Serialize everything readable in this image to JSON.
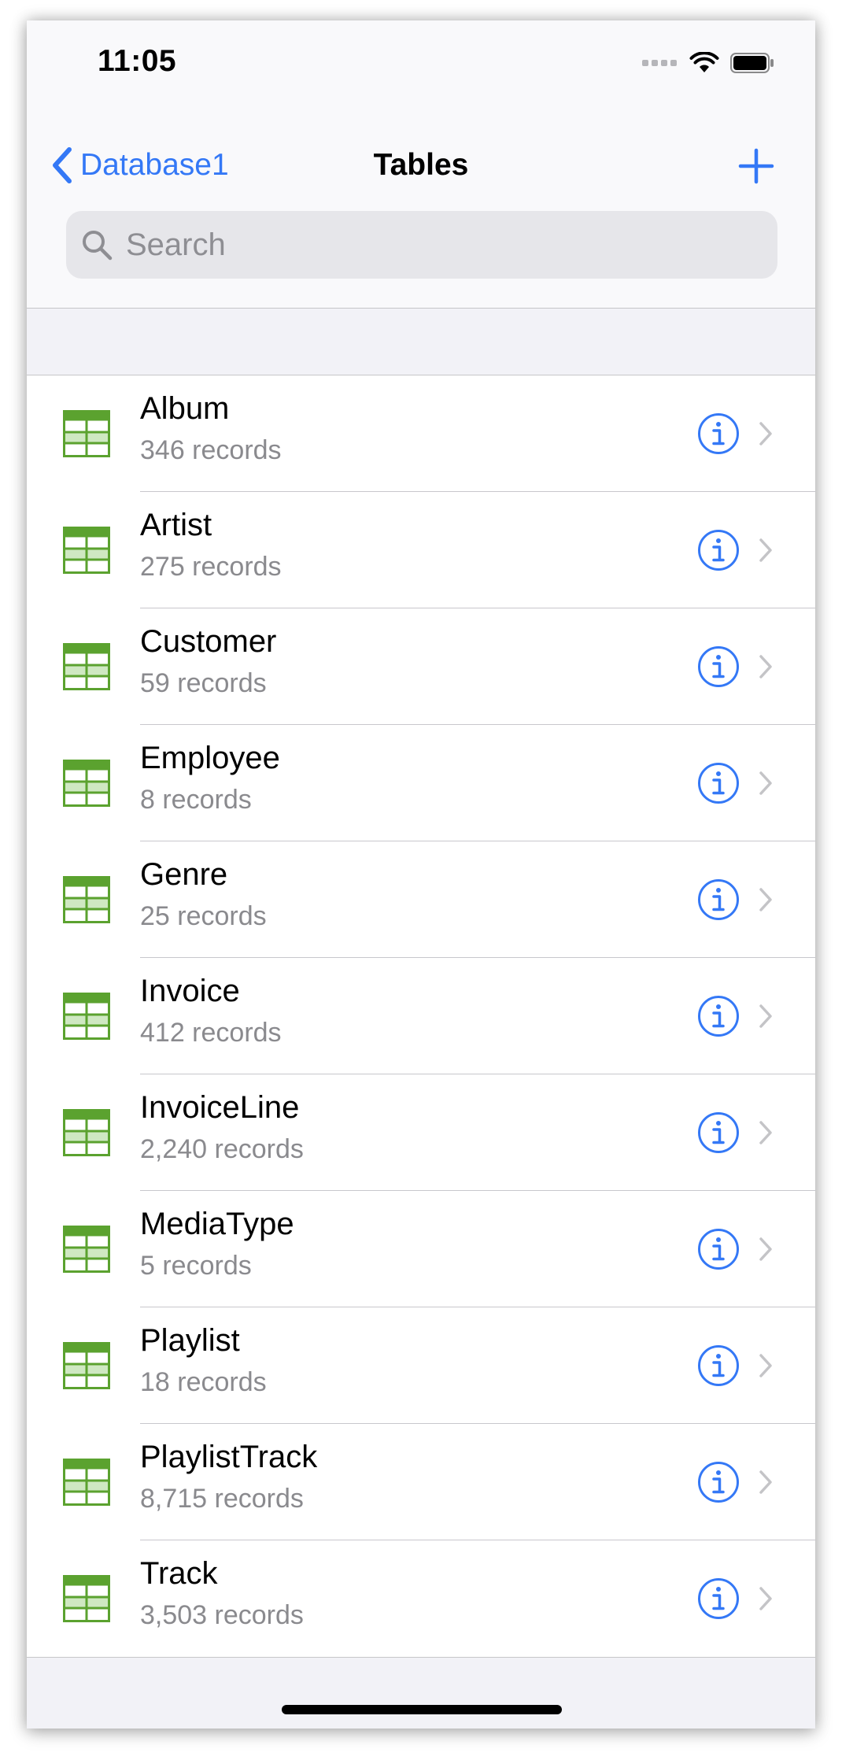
{
  "status_bar": {
    "time": "11:05"
  },
  "nav": {
    "back_label": "Database1",
    "title": "Tables"
  },
  "search": {
    "placeholder": "Search"
  },
  "tables": [
    {
      "name": "Album",
      "count": "346 records"
    },
    {
      "name": "Artist",
      "count": "275 records"
    },
    {
      "name": "Customer",
      "count": "59 records"
    },
    {
      "name": "Employee",
      "count": "8 records"
    },
    {
      "name": "Genre",
      "count": "25 records"
    },
    {
      "name": "Invoice",
      "count": "412 records"
    },
    {
      "name": "InvoiceLine",
      "count": "2,240 records"
    },
    {
      "name": "MediaType",
      "count": "5 records"
    },
    {
      "name": "Playlist",
      "count": "18 records"
    },
    {
      "name": "PlaylistTrack",
      "count": "8,715 records"
    },
    {
      "name": "Track",
      "count": "3,503 records"
    }
  ],
  "icons": {
    "back": "chevron-left-icon",
    "add": "plus-icon",
    "search": "magnifying-glass-icon",
    "table": "table-grid-icon",
    "info": "info-circle-icon",
    "disclosure": "chevron-right-icon"
  },
  "colors": {
    "accent": "#3478f6",
    "table_icon": "#5ba22f",
    "table_icon_fill": "#cfe8c2",
    "secondary_text": "#8a8a8e",
    "background": "#f2f2f7"
  }
}
